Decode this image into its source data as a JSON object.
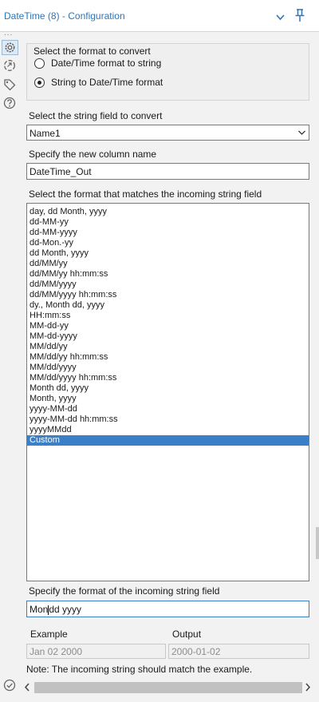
{
  "window": {
    "title": "DateTime (8) - Configuration",
    "icons": [
      "chevron-down-icon",
      "pin-icon"
    ]
  },
  "rail": {
    "dots": "...",
    "icons": [
      "gear-icon",
      "connection-icon",
      "tag-icon",
      "help-icon"
    ]
  },
  "format_group": {
    "title": "Select the format to convert",
    "options": [
      {
        "label": "Date/Time format to string",
        "checked": false
      },
      {
        "label": "String to Date/Time format",
        "checked": true
      }
    ]
  },
  "string_field": {
    "label": "Select the string field to convert",
    "value": "Name1"
  },
  "new_column": {
    "label": "Specify the new column name",
    "value": "DateTime_Out"
  },
  "format_list": {
    "label": "Select the format that matches the incoming string field",
    "items": [
      "day, dd Month, yyyy",
      "dd-MM-yy",
      "dd-MM-yyyy",
      "dd-Mon.-yy",
      "dd Month, yyyy",
      "dd/MM/yy",
      "dd/MM/yy hh:mm:ss",
      "dd/MM/yyyy",
      "dd/MM/yyyy hh:mm:ss",
      "dy., Month dd, yyyy",
      "HH:mm:ss",
      "MM-dd-yy",
      "MM-dd-yyyy",
      "MM/dd/yy",
      "MM/dd/yy hh:mm:ss",
      "MM/dd/yyyy",
      "MM/dd/yyyy hh:mm:ss",
      "Month dd, yyyy",
      "Month, yyyy",
      "yyyy-MM-dd",
      "yyyy-MM-dd hh:mm:ss",
      "yyyyMMdd",
      "Custom"
    ],
    "selected_index": 22
  },
  "custom_format": {
    "label": "Specify the format of the incoming string field",
    "value_before_caret": "Mon",
    "value_after_caret": "dd yyyy"
  },
  "example": {
    "example_label": "Example",
    "example_value": "Jan 02 2000",
    "output_label": "Output",
    "output_value": "2000-01-02",
    "note": "Note: The incoming string should match the example."
  },
  "footer": {
    "icons": [
      "check-circle-icon",
      "scroll-left-icon",
      "scroll-right-icon"
    ]
  },
  "colors": {
    "title_blue": "#2e75b6",
    "selection_blue": "#3b7fc9"
  }
}
